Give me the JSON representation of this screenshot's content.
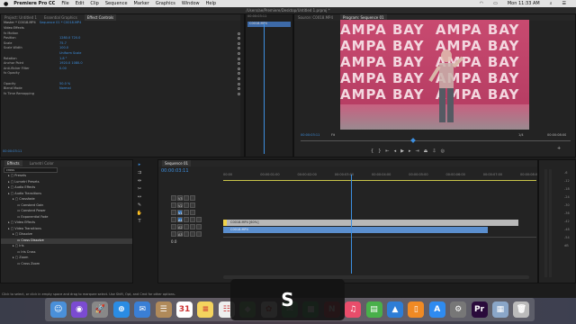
{
  "menubar": {
    "apple": "",
    "app_name": "Premiere Pro CC",
    "items": [
      "File",
      "Edit",
      "Clip",
      "Sequence",
      "Marker",
      "Graphics",
      "Window",
      "Help"
    ],
    "time": "Mon 11:33 AM"
  },
  "document_path": "/Users/ae/Premiere/Desktop/Untitled 1.prproj *",
  "effect_controls": {
    "tabs": [
      "Project: Untitled 1",
      "Essential Graphics",
      "Effect Controls"
    ],
    "clip_source": "Master * C0018.MP4",
    "clip_seq": "Sequence 01 * C0018.MP4",
    "section": "Video Effects",
    "rows": [
      {
        "label": "fx Motion",
        "value": ""
      },
      {
        "label": "Position",
        "value": "1280.0   720.0"
      },
      {
        "label": "Scale",
        "value": "75.7"
      },
      {
        "label": "Scale Width",
        "value": "100.0"
      },
      {
        "label": "",
        "value": "Uniform Scale"
      },
      {
        "label": "Rotation",
        "value": "1.8 °"
      },
      {
        "label": "Anchor Point",
        "value": "1920.0   1080.0"
      },
      {
        "label": "Anti-flicker Filter",
        "value": "0.00"
      },
      {
        "label": "fx Opacity",
        "value": ""
      },
      {
        "label": "",
        "value": ""
      },
      {
        "label": "Opacity",
        "value": "50.0 %"
      },
      {
        "label": "Blend Mode",
        "value": "Normal"
      },
      {
        "label": "fx Time Remapping",
        "value": ""
      }
    ],
    "mini_clip": "C0018.MP4",
    "mini_time": "00:00:03:11",
    "timecode": "00:00:03:11"
  },
  "source_monitor": {
    "tabs": [
      "Source: C0018.MP4",
      "Program: Sequence 01"
    ]
  },
  "program_monitor": {
    "banner_text": "AMPA BAY",
    "timecode": "00:00:03:11",
    "fit": "Fit",
    "res": "1/4",
    "duration": "00:00:08:00"
  },
  "effects_panel": {
    "tabs": [
      "Effects",
      "Lumetri Color"
    ],
    "search": "cross",
    "items": [
      {
        "label": "Presets",
        "indent": 1
      },
      {
        "label": "Lumetri Presets",
        "indent": 1
      },
      {
        "label": "Audio Effects",
        "indent": 1
      },
      {
        "label": "Audio Transitions",
        "indent": 1
      },
      {
        "label": "Crossfade",
        "indent": 2
      },
      {
        "label": "Constant Gain",
        "indent": 3
      },
      {
        "label": "Constant Power",
        "indent": 3
      },
      {
        "label": "Exponential Fade",
        "indent": 3
      },
      {
        "label": "Video Effects",
        "indent": 1
      },
      {
        "label": "Video Transitions",
        "indent": 1
      },
      {
        "label": "Dissolve",
        "indent": 2
      },
      {
        "label": "Cross Dissolve",
        "indent": 3,
        "selected": true
      },
      {
        "label": "Iris",
        "indent": 2
      },
      {
        "label": "Iris Cross",
        "indent": 3
      },
      {
        "label": "Zoom",
        "indent": 2
      },
      {
        "label": "Cross Zoom",
        "indent": 3
      }
    ]
  },
  "timeline": {
    "tab": "Sequence 01",
    "timecode": "00:00:03:11",
    "ruler": [
      "00:00",
      "00:00:01:00",
      "00:00:02:00",
      "00:00:03:00",
      "00:00:04:00",
      "00:00:05:00",
      "00:00:06:00",
      "00:00:07:00",
      "00:00:08:00"
    ],
    "video_tracks": [
      "V3",
      "V2",
      "V1"
    ],
    "audio_tracks": [
      "A1",
      "A2",
      "A3"
    ],
    "clip_v2": "C0018.MP4 [60%]",
    "clip_v1": "C0018.MP4",
    "master": "0.0",
    "playhead_fraction": 0.43
  },
  "status_bar": "Click to select, or click in empty space and drag to marquee select. Use Shift, Opt, and Cmd for other options.",
  "key_overlay": "S",
  "dock": [
    {
      "name": "finder-icon",
      "color": "#4a90d9",
      "glyph": "☺"
    },
    {
      "name": "siri-icon",
      "color": "#7b4bd1",
      "glyph": "◉"
    },
    {
      "name": "launchpad-icon",
      "color": "#888",
      "glyph": "🚀"
    },
    {
      "name": "safari-icon",
      "color": "#2a8ce3",
      "glyph": "⊕"
    },
    {
      "name": "mail-icon",
      "color": "#3a7fd5",
      "glyph": "✉"
    },
    {
      "name": "contacts-icon",
      "color": "#b08a5a",
      "glyph": "☰"
    },
    {
      "name": "calendar-icon",
      "color": "#ffffff",
      "glyph": "31"
    },
    {
      "name": "notes-icon",
      "color": "#f4d35e",
      "glyph": "≡"
    },
    {
      "name": "reminders-icon",
      "color": "#eeeeee",
      "glyph": "☷"
    },
    {
      "name": "maps-icon",
      "color": "#6bb86b",
      "glyph": "◆"
    },
    {
      "name": "photos-icon",
      "color": "#eeeeee",
      "glyph": "✿"
    },
    {
      "name": "messages-icon",
      "color": "#49c06a",
      "glyph": "✉"
    },
    {
      "name": "facetime-icon",
      "color": "#3cb35a",
      "glyph": "■"
    },
    {
      "name": "news-icon",
      "color": "#e2303e",
      "glyph": "N"
    },
    {
      "name": "music-icon",
      "color": "#e94d6b",
      "glyph": "♫"
    },
    {
      "name": "numbers-icon",
      "color": "#49b04a",
      "glyph": "▤"
    },
    {
      "name": "keynote-icon",
      "color": "#2e7dd6",
      "glyph": "▲"
    },
    {
      "name": "books-icon",
      "color": "#f08a24",
      "glyph": "▯"
    },
    {
      "name": "appstore-icon",
      "color": "#2f8bf0",
      "glyph": "A"
    },
    {
      "name": "system-preferences-icon",
      "color": "#777",
      "glyph": "⚙"
    },
    {
      "name": "premiere-icon",
      "color": "#2a0b3b",
      "glyph": "Pr"
    },
    {
      "name": "finder-window-icon",
      "color": "#8aa6c8",
      "glyph": "▦"
    },
    {
      "name": "trash-icon",
      "color": "#bbbbbb",
      "glyph": "🗑"
    }
  ]
}
